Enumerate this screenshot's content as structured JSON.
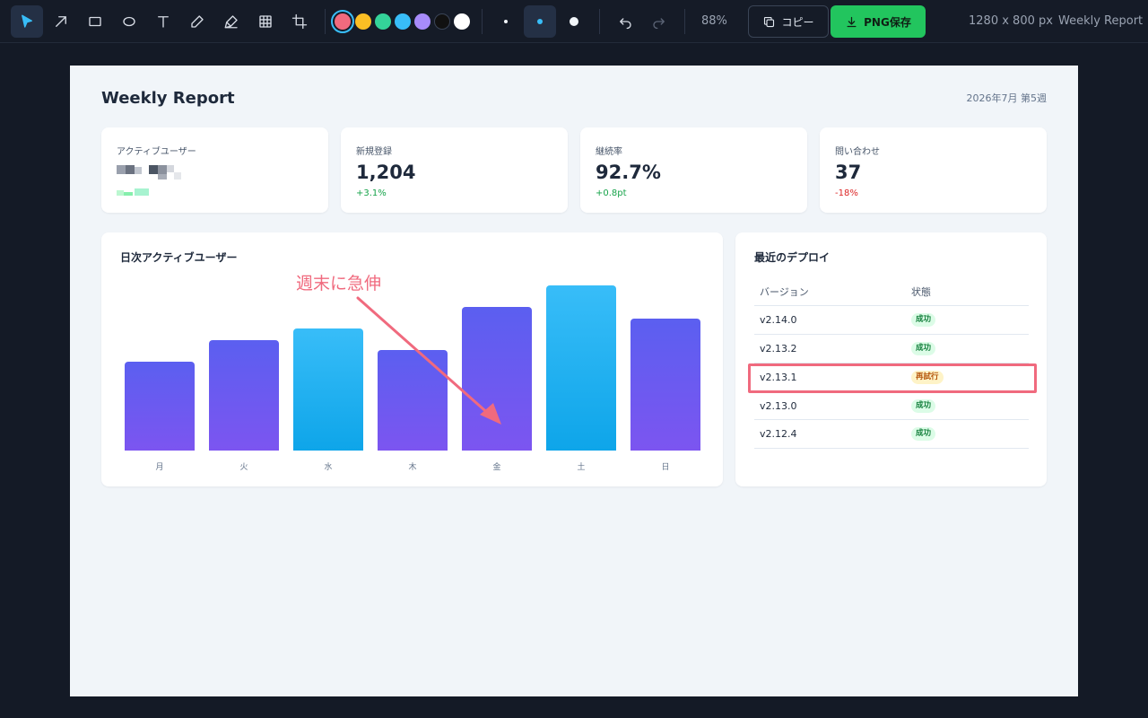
{
  "toolbar": {
    "tools": [
      {
        "name": "select",
        "icon": "cursor-icon",
        "active": true
      },
      {
        "name": "arrow",
        "icon": "arrow-icon"
      },
      {
        "name": "rectangle",
        "icon": "rectangle-icon"
      },
      {
        "name": "ellipse",
        "icon": "ellipse-icon"
      },
      {
        "name": "text",
        "icon": "text-icon"
      },
      {
        "name": "pen",
        "icon": "pen-icon"
      },
      {
        "name": "marker",
        "icon": "highlighter-icon"
      },
      {
        "name": "mosaic",
        "icon": "grid-icon"
      },
      {
        "name": "crop",
        "icon": "crop-icon"
      }
    ],
    "colors": [
      "#f06a7e",
      "#fbbf24",
      "#34d399",
      "#38bdf8",
      "#a78bfa",
      "#111111",
      "#ffffff"
    ],
    "selected_color": "#f06a7e",
    "stroke_sizes": [
      "small",
      "medium",
      "large"
    ],
    "selected_stroke": "medium",
    "undo_icon": "undo-icon",
    "redo_icon": "redo-icon",
    "zoom": "88%",
    "copy_label": "コピー",
    "copy_icon": "copy-icon",
    "save_label": "PNG保存",
    "save_icon": "download-icon",
    "dimensions": "1280 x 800 px",
    "document_name": "Weekly Report"
  },
  "report": {
    "title": "Weekly Report",
    "date": "2026年7月 第5週",
    "kpis": [
      {
        "label": "アクティブユーザー",
        "value": "",
        "delta": "",
        "redacted": true
      },
      {
        "label": "新規登録",
        "value": "1,204",
        "delta": "+3.1%",
        "trend": "up"
      },
      {
        "label": "継続率",
        "value": "92.7%",
        "delta": "+0.8pt",
        "trend": "up"
      },
      {
        "label": "問い合わせ",
        "value": "37",
        "delta": "-18%",
        "trend": "down"
      }
    ],
    "chart_title": "日次アクティブユーザー",
    "annotation_text": "週末に急伸",
    "deploy_title": "最近のデプロイ",
    "deploy_headers": {
      "version": "バージョン",
      "status": "状態"
    },
    "deploys": [
      {
        "version": "v2.14.0",
        "status": "成功",
        "kind": "ok"
      },
      {
        "version": "v2.13.2",
        "status": "成功",
        "kind": "ok"
      },
      {
        "version": "v2.13.1",
        "status": "再試行",
        "kind": "retry",
        "highlighted": true
      },
      {
        "version": "v2.13.0",
        "status": "成功",
        "kind": "ok"
      },
      {
        "version": "v2.12.4",
        "status": "成功",
        "kind": "ok"
      }
    ],
    "colors": {
      "accent_indigo": "#6366f1",
      "accent_sky": "#0ea5e9",
      "annotation": "#f06a7e",
      "success": "#16a34a",
      "danger": "#dc2626"
    }
  },
  "chart_data": {
    "type": "bar",
    "title": "日次アクティブユーザー",
    "categories": [
      "月",
      "火",
      "水",
      "木",
      "金",
      "土",
      "日"
    ],
    "values": [
      0.54,
      0.67,
      0.74,
      0.61,
      0.87,
      1.0,
      0.8
    ],
    "value_note": "relative bar heights (y-axis unlabeled); 土 = 1.0",
    "bar_colors": [
      "indigo",
      "indigo",
      "sky",
      "indigo",
      "indigo",
      "sky",
      "indigo"
    ],
    "ylim": [
      0,
      1
    ],
    "grid": false,
    "legend": "none"
  }
}
